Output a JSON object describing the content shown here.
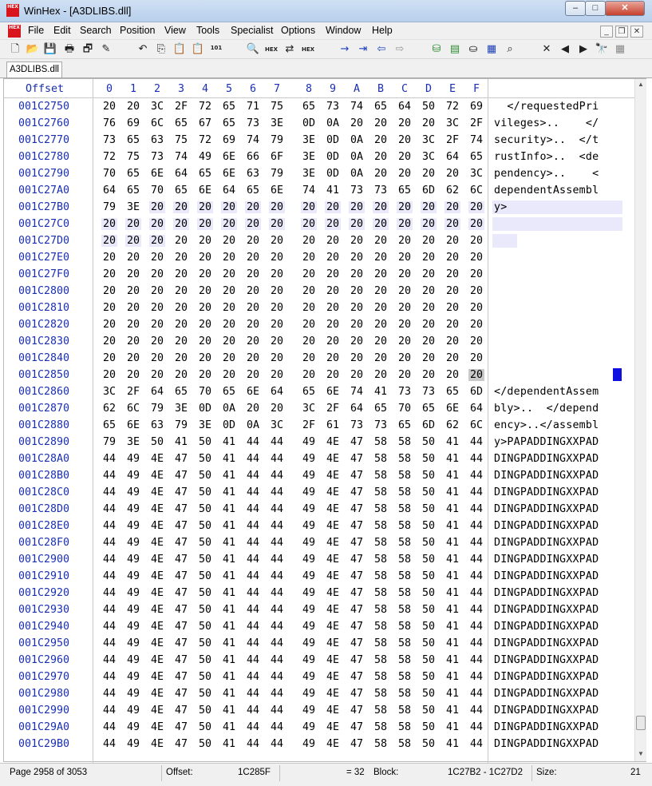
{
  "window": {
    "title": "WinHex - [A3DLIBS.dll]",
    "app_icon_text": "HEX",
    "minimize_glyph": "–",
    "maximize_glyph": "□",
    "close_glyph": "✕"
  },
  "menu": {
    "items": [
      "File",
      "Edit",
      "Search",
      "Position",
      "View",
      "Tools",
      "Specialist",
      "Options",
      "Window",
      "Help"
    ],
    "mdi_minimize": "_",
    "mdi_restore": "❐",
    "mdi_close": "✕"
  },
  "toolbar": {
    "icons": [
      {
        "name": "new-file-icon",
        "glyph": "🗋"
      },
      {
        "name": "open-file-icon",
        "glyph": "📂"
      },
      {
        "name": "save-icon",
        "glyph": "💾"
      },
      {
        "name": "print-icon",
        "glyph": "🖶"
      },
      {
        "name": "properties-icon",
        "glyph": "🗗"
      },
      {
        "name": "edit-icon",
        "glyph": "✎"
      },
      {
        "name": "undo-icon",
        "glyph": "↶"
      },
      {
        "name": "copy-icon",
        "glyph": "⎘"
      },
      {
        "name": "paste-icon",
        "glyph": "📋"
      },
      {
        "name": "paste-write-icon",
        "glyph": "📋"
      },
      {
        "name": "binary-icon",
        "glyph": "101"
      },
      {
        "name": "find-text-icon",
        "glyph": "🔍"
      },
      {
        "name": "find-hex-icon",
        "glyph": "HEX"
      },
      {
        "name": "replace-text-icon",
        "glyph": "⇄"
      },
      {
        "name": "replace-hex-icon",
        "glyph": "HEX"
      },
      {
        "name": "goto-offset-icon",
        "glyph": "→"
      },
      {
        "name": "goto-page-icon",
        "glyph": "⇥"
      },
      {
        "name": "back-icon",
        "glyph": "⇦"
      },
      {
        "name": "forward-icon",
        "glyph": "⇨"
      },
      {
        "name": "disk-icon",
        "glyph": "⛁"
      },
      {
        "name": "ram-icon",
        "glyph": "▤"
      },
      {
        "name": "drive-icon",
        "glyph": "⛀"
      },
      {
        "name": "calculator-icon",
        "glyph": "▦"
      },
      {
        "name": "search-icon",
        "glyph": "⌕"
      },
      {
        "name": "close-file-icon",
        "glyph": "✕"
      },
      {
        "name": "previous-icon",
        "glyph": "◀"
      },
      {
        "name": "next-icon",
        "glyph": "▶"
      },
      {
        "name": "binoculars-icon",
        "glyph": "🔭"
      },
      {
        "name": "grid-icon",
        "glyph": "▦"
      }
    ]
  },
  "tab": {
    "label": "A3DLIBS.dll"
  },
  "editor": {
    "offset_header": "Offset",
    "columns": [
      "0",
      "1",
      "2",
      "3",
      "4",
      "5",
      "6",
      "7",
      "8",
      "9",
      "A",
      "B",
      "C",
      "D",
      "E",
      "F"
    ],
    "rows": [
      {
        "offset": "001C2750",
        "hex": [
          "20",
          "20",
          "3C",
          "2F",
          "72",
          "65",
          "71",
          "75",
          "65",
          "73",
          "74",
          "65",
          "64",
          "50",
          "72",
          "69"
        ],
        "ascii": "  </requestedPri"
      },
      {
        "offset": "001C2760",
        "hex": [
          "76",
          "69",
          "6C",
          "65",
          "67",
          "65",
          "73",
          "3E",
          "0D",
          "0A",
          "20",
          "20",
          "20",
          "20",
          "3C",
          "2F"
        ],
        "ascii": "vileges>..    </"
      },
      {
        "offset": "001C2770",
        "hex": [
          "73",
          "65",
          "63",
          "75",
          "72",
          "69",
          "74",
          "79",
          "3E",
          "0D",
          "0A",
          "20",
          "20",
          "3C",
          "2F",
          "74"
        ],
        "ascii": "security>..  </t"
      },
      {
        "offset": "001C2780",
        "hex": [
          "72",
          "75",
          "73",
          "74",
          "49",
          "6E",
          "66",
          "6F",
          "3E",
          "0D",
          "0A",
          "20",
          "20",
          "3C",
          "64",
          "65"
        ],
        "ascii": "rustInfo>..  <de"
      },
      {
        "offset": "001C2790",
        "hex": [
          "70",
          "65",
          "6E",
          "64",
          "65",
          "6E",
          "63",
          "79",
          "3E",
          "0D",
          "0A",
          "20",
          "20",
          "20",
          "20",
          "3C"
        ],
        "ascii": "pendency>..    <"
      },
      {
        "offset": "001C27A0",
        "hex": [
          "64",
          "65",
          "70",
          "65",
          "6E",
          "64",
          "65",
          "6E",
          "74",
          "41",
          "73",
          "73",
          "65",
          "6D",
          "62",
          "6C"
        ],
        "ascii": "dependentAssembl"
      },
      {
        "offset": "001C27B0",
        "hex": [
          "79",
          "3E",
          "20",
          "20",
          "20",
          "20",
          "20",
          "20",
          "20",
          "20",
          "20",
          "20",
          "20",
          "20",
          "20",
          "20"
        ],
        "ascii": "y>"
      },
      {
        "offset": "001C27C0",
        "hex": [
          "20",
          "20",
          "20",
          "20",
          "20",
          "20",
          "20",
          "20",
          "20",
          "20",
          "20",
          "20",
          "20",
          "20",
          "20",
          "20"
        ],
        "ascii": ""
      },
      {
        "offset": "001C27D0",
        "hex": [
          "20",
          "20",
          "20",
          "20",
          "20",
          "20",
          "20",
          "20",
          "20",
          "20",
          "20",
          "20",
          "20",
          "20",
          "20",
          "20"
        ],
        "ascii": ""
      },
      {
        "offset": "001C27E0",
        "hex": [
          "20",
          "20",
          "20",
          "20",
          "20",
          "20",
          "20",
          "20",
          "20",
          "20",
          "20",
          "20",
          "20",
          "20",
          "20",
          "20"
        ],
        "ascii": ""
      },
      {
        "offset": "001C27F0",
        "hex": [
          "20",
          "20",
          "20",
          "20",
          "20",
          "20",
          "20",
          "20",
          "20",
          "20",
          "20",
          "20",
          "20",
          "20",
          "20",
          "20"
        ],
        "ascii": ""
      },
      {
        "offset": "001C2800",
        "hex": [
          "20",
          "20",
          "20",
          "20",
          "20",
          "20",
          "20",
          "20",
          "20",
          "20",
          "20",
          "20",
          "20",
          "20",
          "20",
          "20"
        ],
        "ascii": ""
      },
      {
        "offset": "001C2810",
        "hex": [
          "20",
          "20",
          "20",
          "20",
          "20",
          "20",
          "20",
          "20",
          "20",
          "20",
          "20",
          "20",
          "20",
          "20",
          "20",
          "20"
        ],
        "ascii": ""
      },
      {
        "offset": "001C2820",
        "hex": [
          "20",
          "20",
          "20",
          "20",
          "20",
          "20",
          "20",
          "20",
          "20",
          "20",
          "20",
          "20",
          "20",
          "20",
          "20",
          "20"
        ],
        "ascii": ""
      },
      {
        "offset": "001C2830",
        "hex": [
          "20",
          "20",
          "20",
          "20",
          "20",
          "20",
          "20",
          "20",
          "20",
          "20",
          "20",
          "20",
          "20",
          "20",
          "20",
          "20"
        ],
        "ascii": ""
      },
      {
        "offset": "001C2840",
        "hex": [
          "20",
          "20",
          "20",
          "20",
          "20",
          "20",
          "20",
          "20",
          "20",
          "20",
          "20",
          "20",
          "20",
          "20",
          "20",
          "20"
        ],
        "ascii": ""
      },
      {
        "offset": "001C2850",
        "hex": [
          "20",
          "20",
          "20",
          "20",
          "20",
          "20",
          "20",
          "20",
          "20",
          "20",
          "20",
          "20",
          "20",
          "20",
          "20",
          "20"
        ],
        "ascii": ""
      },
      {
        "offset": "001C2860",
        "hex": [
          "3C",
          "2F",
          "64",
          "65",
          "70",
          "65",
          "6E",
          "64",
          "65",
          "6E",
          "74",
          "41",
          "73",
          "73",
          "65",
          "6D"
        ],
        "ascii": "</dependentAssem"
      },
      {
        "offset": "001C2870",
        "hex": [
          "62",
          "6C",
          "79",
          "3E",
          "0D",
          "0A",
          "20",
          "20",
          "3C",
          "2F",
          "64",
          "65",
          "70",
          "65",
          "6E",
          "64"
        ],
        "ascii": "bly>..  </depend"
      },
      {
        "offset": "001C2880",
        "hex": [
          "65",
          "6E",
          "63",
          "79",
          "3E",
          "0D",
          "0A",
          "3C",
          "2F",
          "61",
          "73",
          "73",
          "65",
          "6D",
          "62",
          "6C"
        ],
        "ascii": "ency>..</assembl"
      },
      {
        "offset": "001C2890",
        "hex": [
          "79",
          "3E",
          "50",
          "41",
          "50",
          "41",
          "44",
          "44",
          "49",
          "4E",
          "47",
          "58",
          "58",
          "50",
          "41",
          "44"
        ],
        "ascii": "y>PAPADDINGXXPAD"
      },
      {
        "offset": "001C28A0",
        "hex": [
          "44",
          "49",
          "4E",
          "47",
          "50",
          "41",
          "44",
          "44",
          "49",
          "4E",
          "47",
          "58",
          "58",
          "50",
          "41",
          "44"
        ],
        "ascii": "DINGPADDINGXXPAD"
      },
      {
        "offset": "001C28B0",
        "hex": [
          "44",
          "49",
          "4E",
          "47",
          "50",
          "41",
          "44",
          "44",
          "49",
          "4E",
          "47",
          "58",
          "58",
          "50",
          "41",
          "44"
        ],
        "ascii": "DINGPADDINGXXPAD"
      },
      {
        "offset": "001C28C0",
        "hex": [
          "44",
          "49",
          "4E",
          "47",
          "50",
          "41",
          "44",
          "44",
          "49",
          "4E",
          "47",
          "58",
          "58",
          "50",
          "41",
          "44"
        ],
        "ascii": "DINGPADDINGXXPAD"
      },
      {
        "offset": "001C28D0",
        "hex": [
          "44",
          "49",
          "4E",
          "47",
          "50",
          "41",
          "44",
          "44",
          "49",
          "4E",
          "47",
          "58",
          "58",
          "50",
          "41",
          "44"
        ],
        "ascii": "DINGPADDINGXXPAD"
      },
      {
        "offset": "001C28E0",
        "hex": [
          "44",
          "49",
          "4E",
          "47",
          "50",
          "41",
          "44",
          "44",
          "49",
          "4E",
          "47",
          "58",
          "58",
          "50",
          "41",
          "44"
        ],
        "ascii": "DINGPADDINGXXPAD"
      },
      {
        "offset": "001C28F0",
        "hex": [
          "44",
          "49",
          "4E",
          "47",
          "50",
          "41",
          "44",
          "44",
          "49",
          "4E",
          "47",
          "58",
          "58",
          "50",
          "41",
          "44"
        ],
        "ascii": "DINGPADDINGXXPAD"
      },
      {
        "offset": "001C2900",
        "hex": [
          "44",
          "49",
          "4E",
          "47",
          "50",
          "41",
          "44",
          "44",
          "49",
          "4E",
          "47",
          "58",
          "58",
          "50",
          "41",
          "44"
        ],
        "ascii": "DINGPADDINGXXPAD"
      },
      {
        "offset": "001C2910",
        "hex": [
          "44",
          "49",
          "4E",
          "47",
          "50",
          "41",
          "44",
          "44",
          "49",
          "4E",
          "47",
          "58",
          "58",
          "50",
          "41",
          "44"
        ],
        "ascii": "DINGPADDINGXXPAD"
      },
      {
        "offset": "001C2920",
        "hex": [
          "44",
          "49",
          "4E",
          "47",
          "50",
          "41",
          "44",
          "44",
          "49",
          "4E",
          "47",
          "58",
          "58",
          "50",
          "41",
          "44"
        ],
        "ascii": "DINGPADDINGXXPAD"
      },
      {
        "offset": "001C2930",
        "hex": [
          "44",
          "49",
          "4E",
          "47",
          "50",
          "41",
          "44",
          "44",
          "49",
          "4E",
          "47",
          "58",
          "58",
          "50",
          "41",
          "44"
        ],
        "ascii": "DINGPADDINGXXPAD"
      },
      {
        "offset": "001C2940",
        "hex": [
          "44",
          "49",
          "4E",
          "47",
          "50",
          "41",
          "44",
          "44",
          "49",
          "4E",
          "47",
          "58",
          "58",
          "50",
          "41",
          "44"
        ],
        "ascii": "DINGPADDINGXXPAD"
      },
      {
        "offset": "001C2950",
        "hex": [
          "44",
          "49",
          "4E",
          "47",
          "50",
          "41",
          "44",
          "44",
          "49",
          "4E",
          "47",
          "58",
          "58",
          "50",
          "41",
          "44"
        ],
        "ascii": "DINGPADDINGXXPAD"
      },
      {
        "offset": "001C2960",
        "hex": [
          "44",
          "49",
          "4E",
          "47",
          "50",
          "41",
          "44",
          "44",
          "49",
          "4E",
          "47",
          "58",
          "58",
          "50",
          "41",
          "44"
        ],
        "ascii": "DINGPADDINGXXPAD"
      },
      {
        "offset": "001C2970",
        "hex": [
          "44",
          "49",
          "4E",
          "47",
          "50",
          "41",
          "44",
          "44",
          "49",
          "4E",
          "47",
          "58",
          "58",
          "50",
          "41",
          "44"
        ],
        "ascii": "DINGPADDINGXXPAD"
      },
      {
        "offset": "001C2980",
        "hex": [
          "44",
          "49",
          "4E",
          "47",
          "50",
          "41",
          "44",
          "44",
          "49",
          "4E",
          "47",
          "58",
          "58",
          "50",
          "41",
          "44"
        ],
        "ascii": "DINGPADDINGXXPAD"
      },
      {
        "offset": "001C2990",
        "hex": [
          "44",
          "49",
          "4E",
          "47",
          "50",
          "41",
          "44",
          "44",
          "49",
          "4E",
          "47",
          "58",
          "58",
          "50",
          "41",
          "44"
        ],
        "ascii": "DINGPADDINGXXPAD"
      },
      {
        "offset": "001C29A0",
        "hex": [
          "44",
          "49",
          "4E",
          "47",
          "50",
          "41",
          "44",
          "44",
          "49",
          "4E",
          "47",
          "58",
          "58",
          "50",
          "41",
          "44"
        ],
        "ascii": "DINGPADDINGXXPAD"
      },
      {
        "offset": "001C29B0",
        "hex": [
          "44",
          "49",
          "4E",
          "47",
          "50",
          "41",
          "44",
          "44",
          "49",
          "4E",
          "47",
          "58",
          "58",
          "50",
          "41",
          "44"
        ],
        "ascii": "DINGPADDINGXXPAD"
      }
    ],
    "selection_color": "#e9e9fb",
    "cursor_color": "#1010e0",
    "offset_color": "#1a2fb0"
  },
  "statusbar": {
    "page": "Page 2958 of 3053",
    "offset_label": "Offset:",
    "offset_value": "1C285F",
    "value": "= 32",
    "block_label": "Block:",
    "block_value": "1C27B2 - 1C27D2",
    "size_label": "Size:",
    "size_value": "21"
  }
}
